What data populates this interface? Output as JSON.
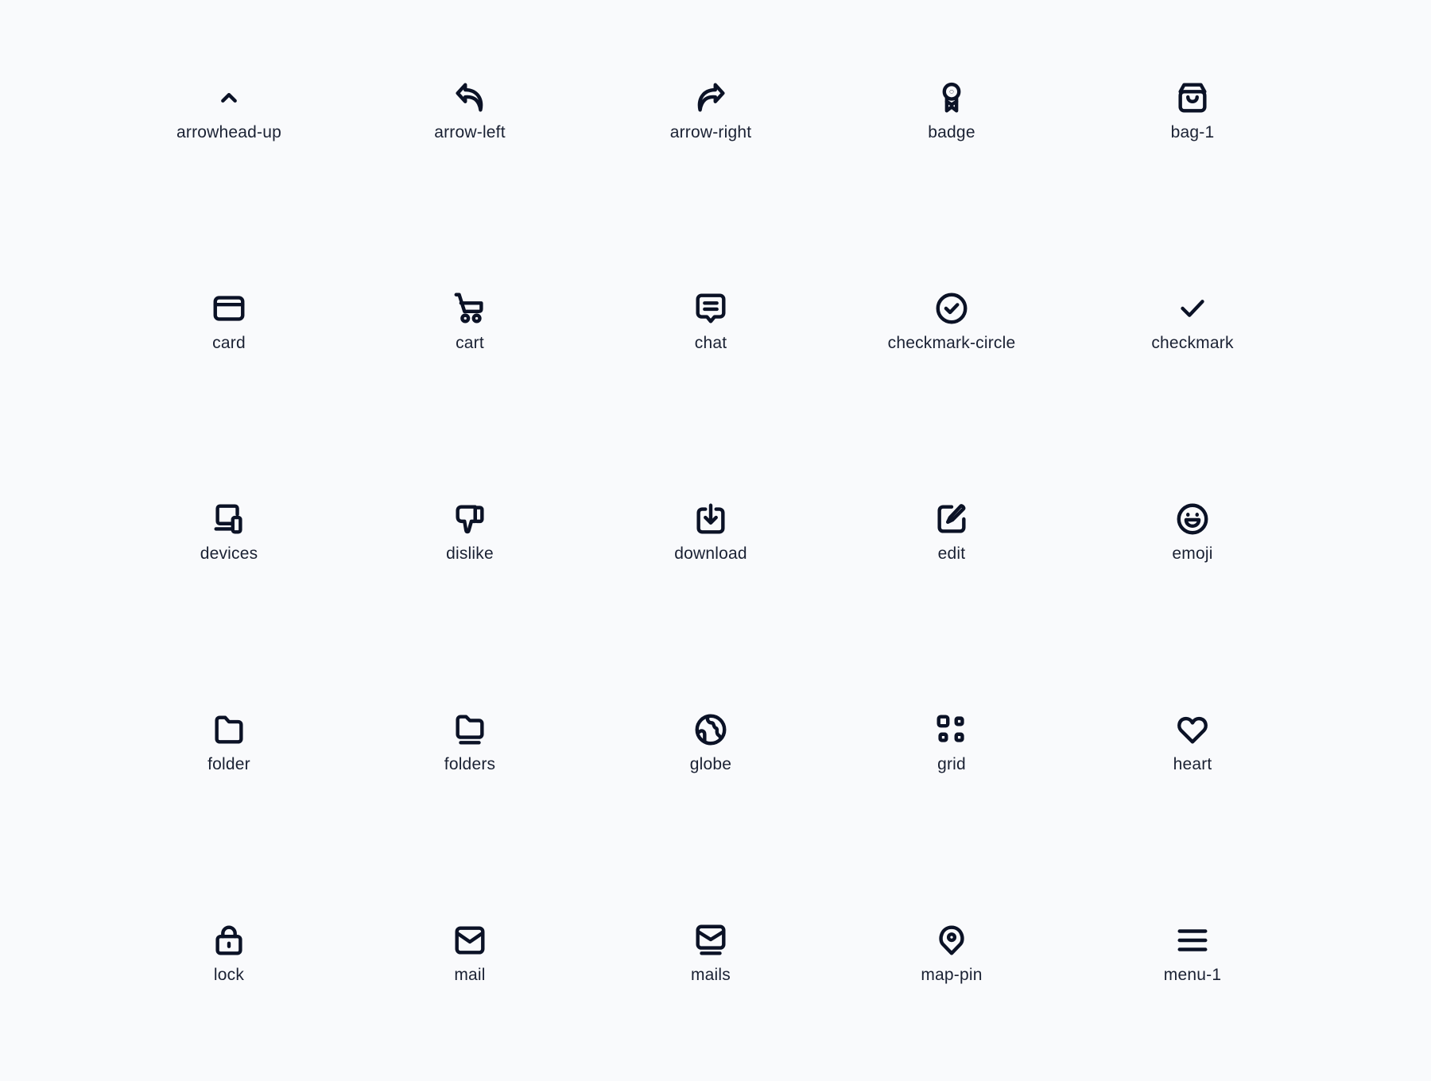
{
  "page": {
    "background": "#f9fafc",
    "icon_color": "#0b1226",
    "text_color": "#1a2133"
  },
  "icons": [
    {
      "label": "arrowhead-up",
      "icon": "arrowhead-up-icon"
    },
    {
      "label": "arrow-left",
      "icon": "arrow-left-icon"
    },
    {
      "label": "arrow-right",
      "icon": "arrow-right-icon"
    },
    {
      "label": "badge",
      "icon": "badge-icon"
    },
    {
      "label": "bag-1",
      "icon": "bag-icon"
    },
    {
      "label": "card",
      "icon": "card-icon"
    },
    {
      "label": "cart",
      "icon": "cart-icon"
    },
    {
      "label": "chat",
      "icon": "chat-icon"
    },
    {
      "label": "checkmark-circle",
      "icon": "checkmark-circle-icon"
    },
    {
      "label": "checkmark",
      "icon": "checkmark-icon"
    },
    {
      "label": "devices",
      "icon": "devices-icon"
    },
    {
      "label": "dislike",
      "icon": "dislike-icon"
    },
    {
      "label": "download",
      "icon": "download-icon"
    },
    {
      "label": "edit",
      "icon": "edit-icon"
    },
    {
      "label": "emoji",
      "icon": "emoji-icon"
    },
    {
      "label": "folder",
      "icon": "folder-icon"
    },
    {
      "label": "folders",
      "icon": "folders-icon"
    },
    {
      "label": "globe",
      "icon": "globe-icon"
    },
    {
      "label": "grid",
      "icon": "grid-icon"
    },
    {
      "label": "heart",
      "icon": "heart-icon"
    },
    {
      "label": "lock",
      "icon": "lock-icon"
    },
    {
      "label": "mail",
      "icon": "mail-icon"
    },
    {
      "label": "mails",
      "icon": "mails-icon"
    },
    {
      "label": "map-pin",
      "icon": "map-pin-icon"
    },
    {
      "label": "menu-1",
      "icon": "menu-icon"
    }
  ]
}
